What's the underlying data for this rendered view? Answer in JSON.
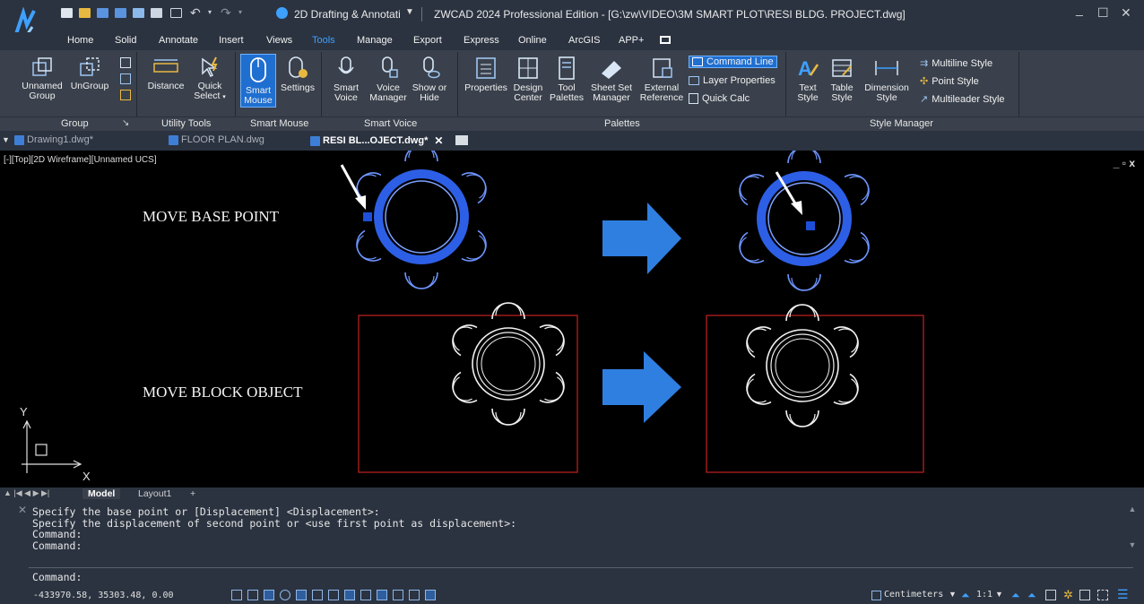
{
  "titlebar": {
    "workspace": "2D Drafting & Annotati",
    "title": "ZWCAD 2024 Professional Edition - [G:\\zw\\VIDEO\\3M SMART PLOT\\RESI BLDG. PROJECT.dwg]",
    "min": "_",
    "max": "☐",
    "close": "✕"
  },
  "ribbon_tabs": [
    "Home",
    "Solid",
    "Annotate",
    "Insert",
    "Views",
    "Tools",
    "Manage",
    "Export",
    "Express",
    "Online",
    "ArcGIS",
    "APP+"
  ],
  "active_tab": "Tools",
  "ribbon": {
    "unnamed_group": "Unnamed Group",
    "ungroup": "UnGroup",
    "distance": "Distance",
    "quick_select": "Quick Select",
    "smart_mouse": "Smart Mouse",
    "settings": "Settings",
    "smart_voice": "Smart Voice",
    "voice_manager": "Voice Manager",
    "show_or_hide": "Show or Hide",
    "properties": "Properties",
    "design_center": "Design Center",
    "tool_palettes": "Tool Palettes",
    "sheet_set_manager": "Sheet Set Manager",
    "external_reference": "External Reference",
    "command_line": "Command Line",
    "layer_properties": "Layer Properties",
    "quick_calc": "Quick Calc",
    "text_style": "Text Style",
    "table_style": "Table Style",
    "dimension_style": "Dimension Style",
    "multiline_style": "Multiline Style",
    "point_style": "Point Style",
    "multileader_style": "Multileader Style",
    "groups": {
      "group": "Group",
      "utility_tools": "Utility Tools",
      "smart_mouse": "Smart Mouse",
      "smart_voice": "Smart Voice",
      "palettes": "Palettes",
      "style_manager": "Style Manager"
    }
  },
  "doc_tabs": [
    "Drawing1.dwg*",
    "FLOOR PLAN.dwg",
    "RESI BL...OJECT.dwg*"
  ],
  "canvas": {
    "viewport_label": "[-][Top][2D Wireframe][Unnamed UCS]",
    "canvas_controls": "_ ▫ x",
    "label_base_point": "MOVE BASE POINT",
    "label_block_object": "MOVE BLOCK OBJECT",
    "axis_y": "Y",
    "axis_x": "X"
  },
  "layout_tabs": [
    "Model",
    "Layout1",
    "+"
  ],
  "command": {
    "history": [
      "Specify the base point or [Displacement] <Displacement>:",
      "Specify the displacement of second point or <use first point as displacement>:",
      "Command:",
      "Command:"
    ],
    "prompt": "Command:"
  },
  "status": {
    "coords": "-433970.58, 35303.48, 0.00",
    "units": "Centimeters",
    "scale": "1:1"
  },
  "colors": {
    "accent": "#3ea0ff",
    "arrow": "#2f7fe0",
    "table_blue": "#2d5fe6",
    "frame_red": "#c42222"
  }
}
